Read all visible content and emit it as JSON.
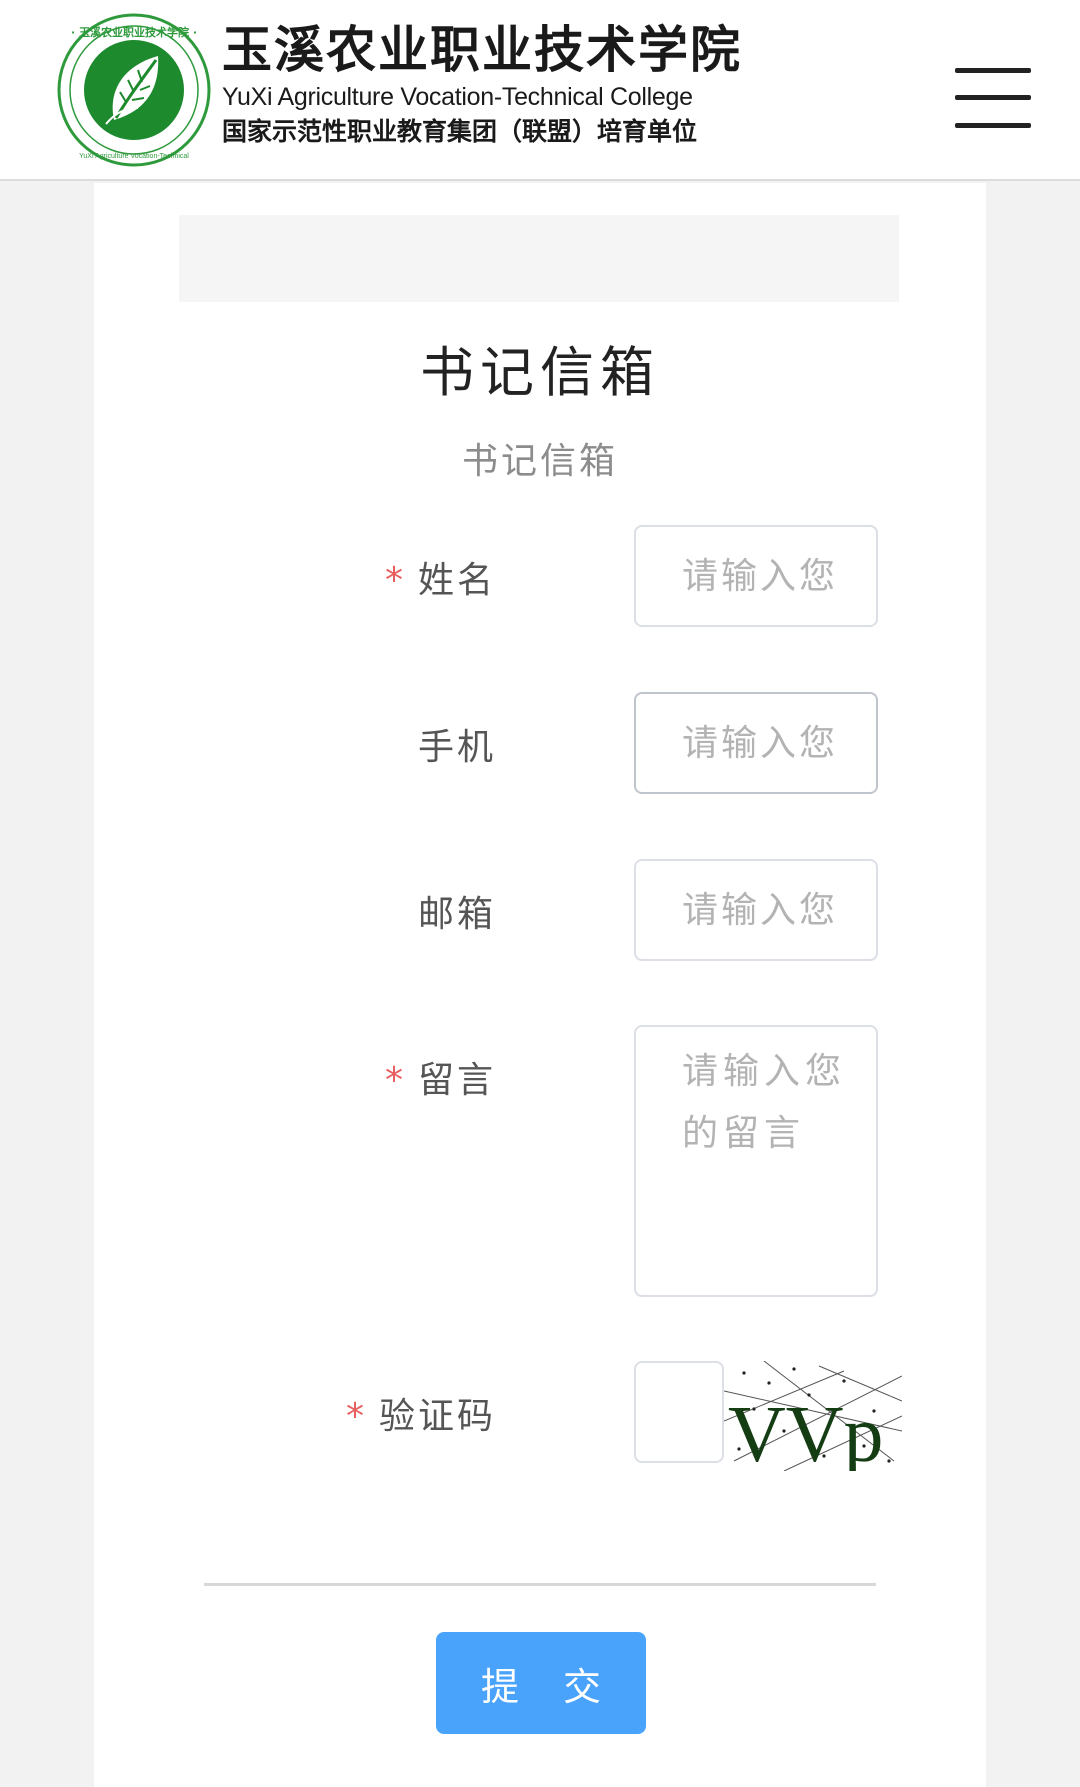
{
  "header": {
    "logo_cn": "玉溪农业职业技术学院",
    "logo_en": "YuXi Agriculture Vocation-Technical College",
    "logo_sub": "国家示范性职业教育集团（联盟）培育单位",
    "emblem_ring_text": "玉溪农业职业技术学院 YuXi Agriculture Vocation-Technical College",
    "menu_icon": "hamburger-menu-icon"
  },
  "page": {
    "title": "书记信箱",
    "subtitle": "书记信箱"
  },
  "form": {
    "required_mark": "*",
    "name_label": "姓名",
    "name_placeholder": "请输入您",
    "phone_label": "手机",
    "phone_placeholder": "请输入您",
    "email_label": "邮箱",
    "email_placeholder": "请输入您",
    "message_label": "留言",
    "message_placeholder": "请输入您的留言",
    "captcha_label": "验证码",
    "captcha_image_text": "VVp",
    "submit_label": "提 交"
  },
  "colors": {
    "accent": "#4aa3fb",
    "required": "#e85d5d",
    "logo_green": "#1e8a2e"
  }
}
